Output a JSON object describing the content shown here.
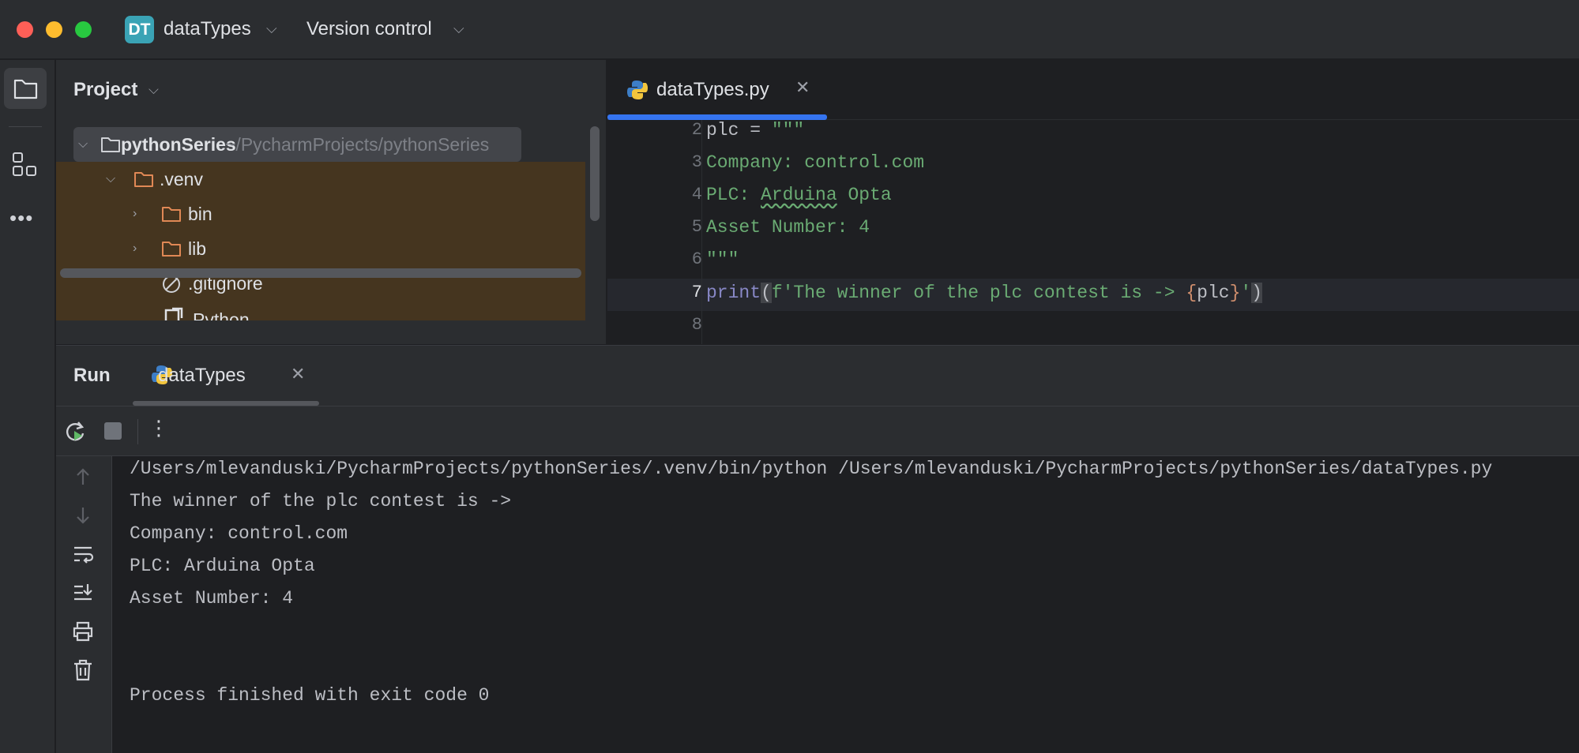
{
  "titlebar": {
    "project_badge": "DT",
    "project_name": "dataTypes",
    "vcs_label": "Version control",
    "badge_color": "#3aa3b5"
  },
  "toolstrip": {
    "items": [
      "project-folder-icon",
      "structure-icon",
      "more-icon"
    ]
  },
  "project_panel": {
    "title": "Project",
    "tree": [
      {
        "name": "pythonSeries",
        "path": "~/PycharmProjects/pythonSeries",
        "type": "folder",
        "expanded": true
      },
      {
        "name": ".venv",
        "type": "folder",
        "expanded": true
      },
      {
        "name": "bin",
        "type": "folder",
        "expanded": false
      },
      {
        "name": "lib",
        "type": "folder",
        "expanded": false
      },
      {
        "name": ".gitignore",
        "type": "file"
      },
      {
        "name": "Python",
        "type": "symlink"
      }
    ]
  },
  "editor": {
    "tab_label": "dataTypes.py",
    "lines": [
      {
        "num": "2"
      },
      {
        "num": "3"
      },
      {
        "num": "4"
      },
      {
        "num": "5"
      },
      {
        "num": "6"
      },
      {
        "num": "7"
      },
      {
        "num": "8"
      }
    ],
    "code": {
      "l2_a": "plc = ",
      "l2_b": "\"\"\"",
      "l3": "Company: control.com",
      "l4_a": "PLC: ",
      "l4_b": "Arduina",
      "l4_c": " Opta",
      "l5": "Asset Number: 4",
      "l6": "\"\"\"",
      "l7_print": "print",
      "l7_open": "(",
      "l7_str": "f'The winner of the plc contest is -> ",
      "l7_lbrace": "{",
      "l7_var": "plc",
      "l7_rbrace": "}",
      "l7_quote": "'",
      "l7_close": ")"
    },
    "accent": "#3574f0"
  },
  "run_panel": {
    "title": "Run",
    "tab_label": "dataTypes",
    "console": [
      "/Users/mlevanduski/PycharmProjects/pythonSeries/.venv/bin/python /Users/mlevanduski/PycharmProjects/pythonSeries/dataTypes.py",
      "The winner of the plc contest is ->",
      "Company: control.com",
      "PLC: Arduina Opta",
      "Asset Number: 4",
      "",
      "",
      "Process finished with exit code 0"
    ]
  }
}
